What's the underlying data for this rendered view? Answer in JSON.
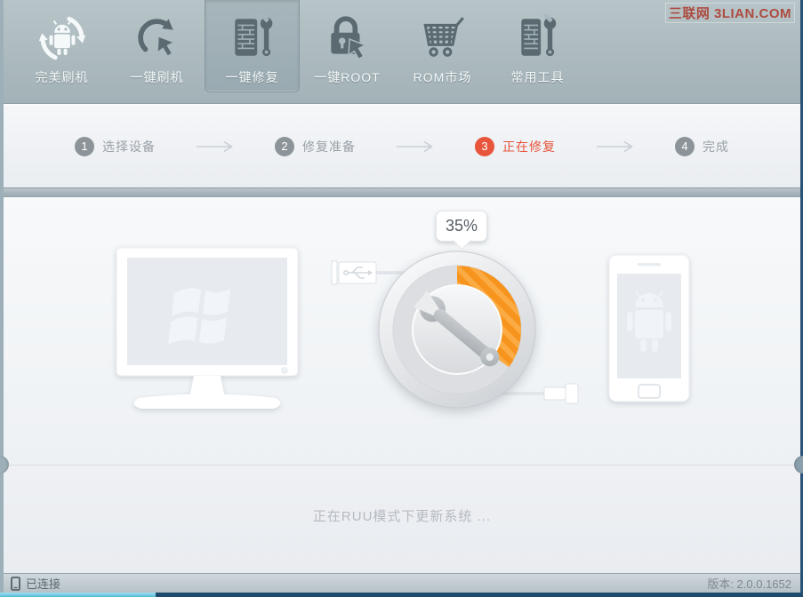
{
  "watermark": "三联网 3LIAN.COM",
  "toolbar": {
    "items": [
      {
        "label": "完美刷机",
        "icon": "app-logo-android",
        "active": false
      },
      {
        "label": "一键刷机",
        "icon": "one-key-flash",
        "active": false
      },
      {
        "label": "一键修复",
        "icon": "one-key-repair",
        "active": true
      },
      {
        "label": "一键ROOT",
        "icon": "one-key-root",
        "active": false
      },
      {
        "label": "ROM市场",
        "icon": "rom-market-cart",
        "active": false
      },
      {
        "label": "常用工具",
        "icon": "common-tools",
        "active": false
      }
    ]
  },
  "steps": [
    {
      "num": "1",
      "label": "选择设备",
      "active": false
    },
    {
      "num": "2",
      "label": "修复准备",
      "active": false
    },
    {
      "num": "3",
      "label": "正在修复",
      "active": true
    },
    {
      "num": "4",
      "label": "完成",
      "active": false
    }
  ],
  "progress": {
    "percent": "35%",
    "value": 35
  },
  "message": "正在RUU模式下更新系统 ...",
  "statusbar": {
    "connection": "已连接",
    "version": "版本: 2.0.0.1652"
  },
  "colors": {
    "accent": "#e8553c",
    "progress_orange": "#f7941e",
    "progress_stripe": "#fbab43",
    "icon_gray": "#5b6a71"
  }
}
